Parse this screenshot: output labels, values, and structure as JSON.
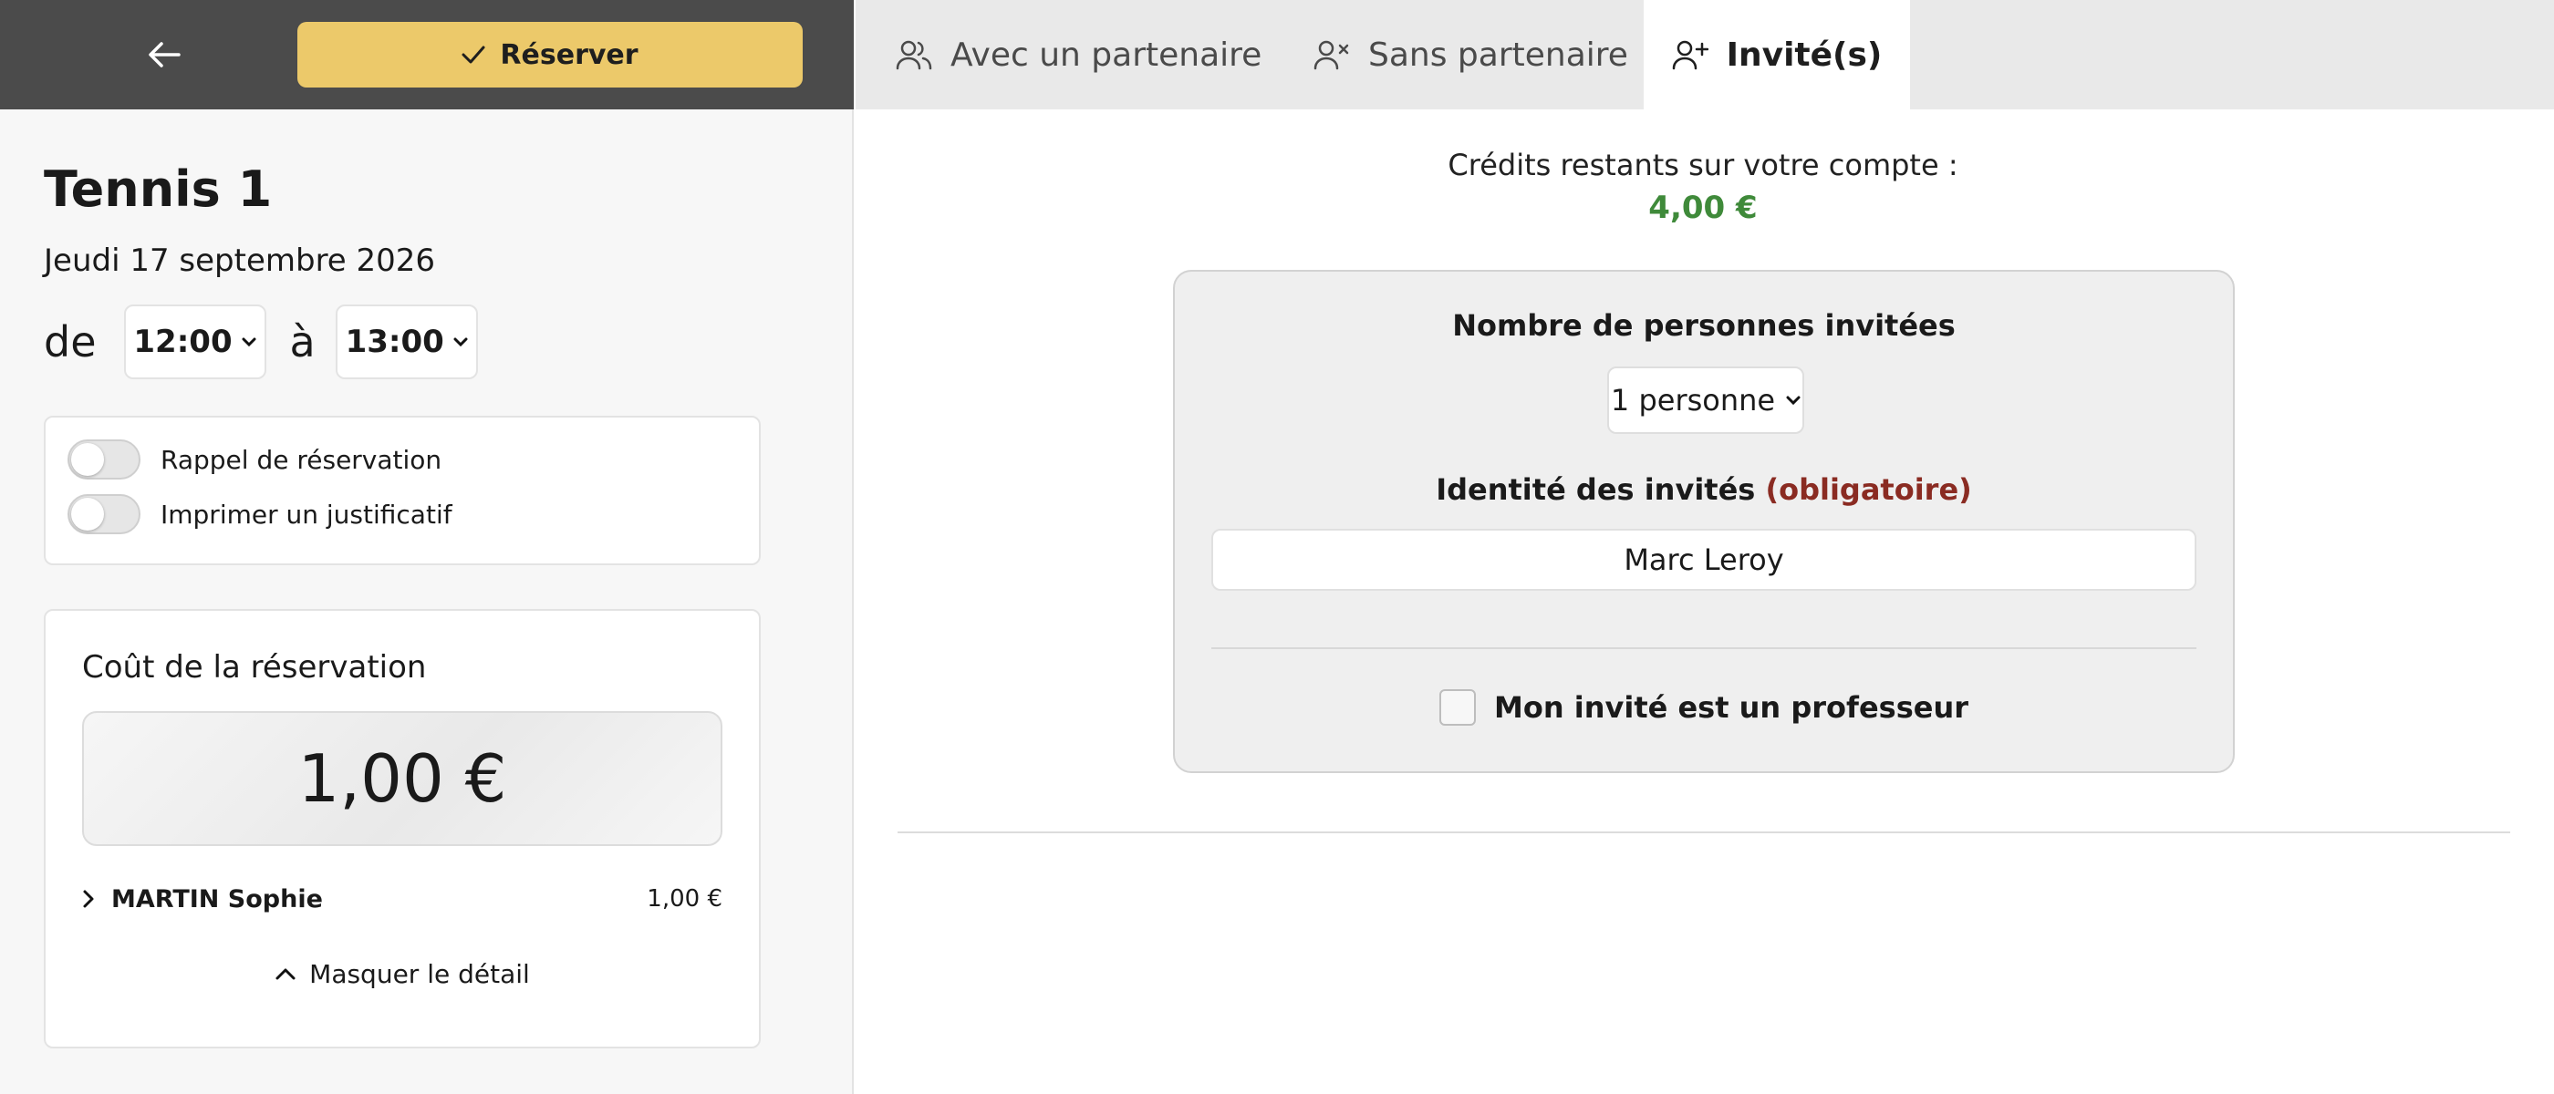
{
  "toolbar": {
    "reserve_label": "Réserver"
  },
  "tabs": [
    {
      "label": "Avec un partenaire",
      "icon": "users-icon",
      "active": false
    },
    {
      "label": "Sans partenaire",
      "icon": "user-x-icon",
      "active": false
    },
    {
      "label": "Invité(s)",
      "icon": "user-plus-icon",
      "active": true
    }
  ],
  "booking": {
    "court": "Tennis 1",
    "date": "Jeudi 17 septembre 2026",
    "from_word": "de",
    "to_word": "à",
    "start_time": "12:00",
    "end_time": "13:00"
  },
  "options": [
    {
      "label": "Rappel de réservation",
      "enabled": false
    },
    {
      "label": "Imprimer un justificatif",
      "enabled": false
    }
  ],
  "cost": {
    "title": "Coût de la réservation",
    "total": "1,00 €",
    "lines": [
      {
        "name": "MARTIN Sophie",
        "amount": "1,00 €"
      }
    ],
    "toggle_label": "Masquer le détail"
  },
  "credits": {
    "label": "Crédits restants sur votre compte :",
    "value": "4,00 €",
    "color": "#3f8a3a"
  },
  "guests": {
    "count_label": "Nombre de personnes invitées",
    "count_value": "1 personne",
    "identity_label": "Identité des invités",
    "identity_required": "(obligatoire)",
    "guest_name": "Marc Leroy",
    "professor_label": "Mon invité est un professeur",
    "professor_checked": false
  },
  "colors": {
    "accent": "#ecc96a",
    "topbar": "#4b4b4b",
    "required": "#8a2b22"
  }
}
